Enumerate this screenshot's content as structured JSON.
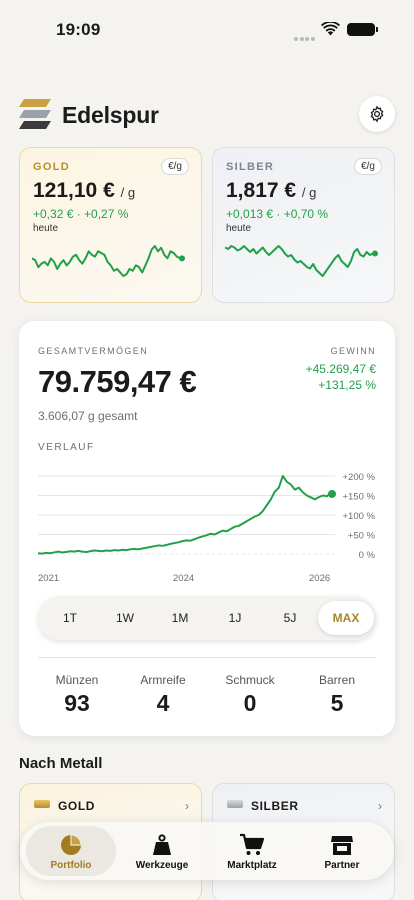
{
  "status": {
    "time": "19:09"
  },
  "app": {
    "title": "Edelspur"
  },
  "metals": {
    "gold": {
      "label": "GOLD",
      "unit": "€/g",
      "price": "121,10 €",
      "per": "/ g",
      "change": "+0,32 € · +0,27 %",
      "period": "heute",
      "spark": [
        20,
        19,
        15,
        17,
        18,
        16,
        20,
        18,
        14,
        17,
        19,
        16,
        18,
        21,
        22,
        19,
        17,
        20,
        24,
        22,
        21,
        24,
        23,
        22,
        18,
        16,
        13,
        14,
        12,
        10,
        11,
        14,
        13,
        16,
        15,
        12,
        16,
        20,
        25,
        27,
        24,
        26,
        22,
        20,
        24,
        23,
        21,
        20
      ]
    },
    "silver": {
      "label": "SILBER",
      "unit": "€/g",
      "price": "1,817 €",
      "per": "/ g",
      "change": "+0,013 € · +0,70 %",
      "period": "heute",
      "spark": [
        23,
        22,
        24,
        23,
        21,
        22,
        24,
        22,
        20,
        22,
        19,
        21,
        23,
        20,
        18,
        20,
        22,
        24,
        22,
        19,
        17,
        18,
        15,
        13,
        14,
        12,
        10,
        9,
        12,
        8,
        6,
        4,
        7,
        10,
        13,
        16,
        18,
        14,
        12,
        10,
        14,
        20,
        22,
        18,
        17,
        20,
        18,
        19
      ]
    }
  },
  "portfolio": {
    "label": "GESAMTVERMÖGEN",
    "total": "79.759,47 €",
    "weight": "3.606,07 g gesamt",
    "gain_label": "GEWINN",
    "gain_abs": "+45.269,47 €",
    "gain_pct": "+131,25 %",
    "chart_title": "VERLAUF"
  },
  "chart_data": {
    "type": "line",
    "title": "VERLAUF",
    "xlabel": "",
    "ylabel": "",
    "x_ticks": [
      "2021",
      "2024",
      "2026"
    ],
    "y_ticks": [
      "+200 %",
      "+150 %",
      "+100 %",
      "+50 %",
      "0 %"
    ],
    "ylim": [
      0,
      200
    ],
    "grid": true,
    "series": [
      {
        "values": [
          2,
          1,
          3,
          2,
          4,
          6,
          4,
          5,
          7,
          6,
          8,
          6,
          5,
          7,
          9,
          8,
          7,
          9,
          8,
          10,
          9,
          11,
          10,
          12,
          13,
          12,
          14,
          16,
          18,
          20,
          22,
          21,
          23,
          26,
          28,
          30,
          33,
          35,
          34,
          38,
          42,
          45,
          48,
          52,
          50,
          55,
          60,
          58,
          64,
          70,
          72,
          78,
          84,
          90,
          96,
          100,
          110,
          125,
          140,
          160,
          170,
          200,
          185,
          178,
          165,
          170,
          158,
          150,
          145,
          140,
          146,
          150,
          148,
          158
        ]
      }
    ],
    "end_value": 154
  },
  "ranges": {
    "items": [
      "1T",
      "1W",
      "1M",
      "1J",
      "5J",
      "MAX"
    ],
    "active": 5
  },
  "counts": [
    {
      "label": "Münzen",
      "value": "93"
    },
    {
      "label": "Armreife",
      "value": "4"
    },
    {
      "label": "Schmuck",
      "value": "0"
    },
    {
      "label": "Barren",
      "value": "5"
    }
  ],
  "by_metal": {
    "title": "Nach Metall",
    "gold_name": "GOLD",
    "silver_name": "SILBER"
  },
  "tabs": {
    "portfolio": "Portfolio",
    "tools": "Werkzeuge",
    "market": "Marktplatz",
    "partner": "Partner"
  },
  "colors": {
    "accent": "#a88726",
    "positive": "#22a04b",
    "line": "#23a04a"
  }
}
